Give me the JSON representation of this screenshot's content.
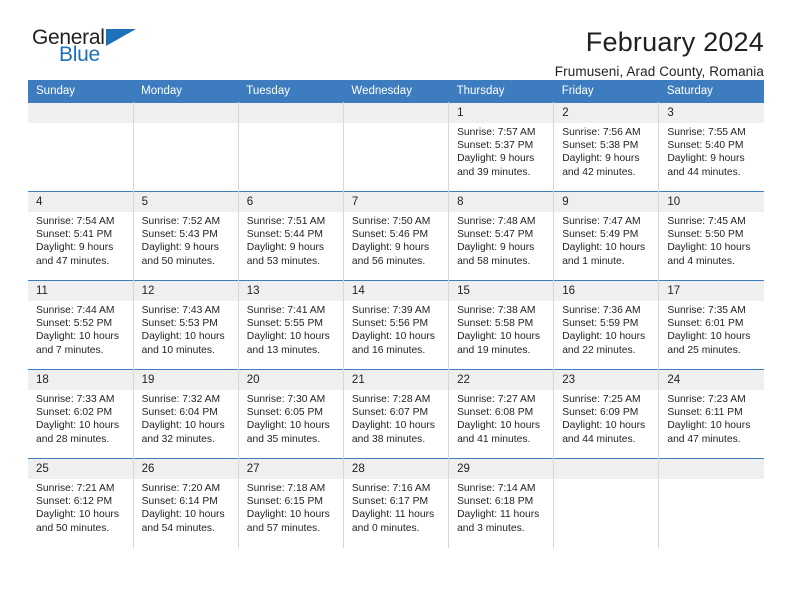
{
  "logo": {
    "text_top": "General",
    "text_bottom": "Blue",
    "triangle_color": "#1d71b8"
  },
  "header": {
    "month_title": "February 2024",
    "location": "Frumuseni, Arad County, Romania"
  },
  "colors": {
    "header_blue": "#3c7cbf",
    "daynum_band": "#efefef",
    "text": "#231f20"
  },
  "weekday_headers": [
    "Sunday",
    "Monday",
    "Tuesday",
    "Wednesday",
    "Thursday",
    "Friday",
    "Saturday"
  ],
  "weeks": [
    [
      {
        "day": "",
        "lines": ""
      },
      {
        "day": "",
        "lines": ""
      },
      {
        "day": "",
        "lines": ""
      },
      {
        "day": "",
        "lines": ""
      },
      {
        "day": "1",
        "lines": "Sunrise: 7:57 AM\nSunset: 5:37 PM\nDaylight: 9 hours\nand 39 minutes."
      },
      {
        "day": "2",
        "lines": "Sunrise: 7:56 AM\nSunset: 5:38 PM\nDaylight: 9 hours\nand 42 minutes."
      },
      {
        "day": "3",
        "lines": "Sunrise: 7:55 AM\nSunset: 5:40 PM\nDaylight: 9 hours\nand 44 minutes."
      }
    ],
    [
      {
        "day": "4",
        "lines": "Sunrise: 7:54 AM\nSunset: 5:41 PM\nDaylight: 9 hours\nand 47 minutes."
      },
      {
        "day": "5",
        "lines": "Sunrise: 7:52 AM\nSunset: 5:43 PM\nDaylight: 9 hours\nand 50 minutes."
      },
      {
        "day": "6",
        "lines": "Sunrise: 7:51 AM\nSunset: 5:44 PM\nDaylight: 9 hours\nand 53 minutes."
      },
      {
        "day": "7",
        "lines": "Sunrise: 7:50 AM\nSunset: 5:46 PM\nDaylight: 9 hours\nand 56 minutes."
      },
      {
        "day": "8",
        "lines": "Sunrise: 7:48 AM\nSunset: 5:47 PM\nDaylight: 9 hours\nand 58 minutes."
      },
      {
        "day": "9",
        "lines": "Sunrise: 7:47 AM\nSunset: 5:49 PM\nDaylight: 10 hours\nand 1 minute."
      },
      {
        "day": "10",
        "lines": "Sunrise: 7:45 AM\nSunset: 5:50 PM\nDaylight: 10 hours\nand 4 minutes."
      }
    ],
    [
      {
        "day": "11",
        "lines": "Sunrise: 7:44 AM\nSunset: 5:52 PM\nDaylight: 10 hours\nand 7 minutes."
      },
      {
        "day": "12",
        "lines": "Sunrise: 7:43 AM\nSunset: 5:53 PM\nDaylight: 10 hours\nand 10 minutes."
      },
      {
        "day": "13",
        "lines": "Sunrise: 7:41 AM\nSunset: 5:55 PM\nDaylight: 10 hours\nand 13 minutes."
      },
      {
        "day": "14",
        "lines": "Sunrise: 7:39 AM\nSunset: 5:56 PM\nDaylight: 10 hours\nand 16 minutes."
      },
      {
        "day": "15",
        "lines": "Sunrise: 7:38 AM\nSunset: 5:58 PM\nDaylight: 10 hours\nand 19 minutes."
      },
      {
        "day": "16",
        "lines": "Sunrise: 7:36 AM\nSunset: 5:59 PM\nDaylight: 10 hours\nand 22 minutes."
      },
      {
        "day": "17",
        "lines": "Sunrise: 7:35 AM\nSunset: 6:01 PM\nDaylight: 10 hours\nand 25 minutes."
      }
    ],
    [
      {
        "day": "18",
        "lines": "Sunrise: 7:33 AM\nSunset: 6:02 PM\nDaylight: 10 hours\nand 28 minutes."
      },
      {
        "day": "19",
        "lines": "Sunrise: 7:32 AM\nSunset: 6:04 PM\nDaylight: 10 hours\nand 32 minutes."
      },
      {
        "day": "20",
        "lines": "Sunrise: 7:30 AM\nSunset: 6:05 PM\nDaylight: 10 hours\nand 35 minutes."
      },
      {
        "day": "21",
        "lines": "Sunrise: 7:28 AM\nSunset: 6:07 PM\nDaylight: 10 hours\nand 38 minutes."
      },
      {
        "day": "22",
        "lines": "Sunrise: 7:27 AM\nSunset: 6:08 PM\nDaylight: 10 hours\nand 41 minutes."
      },
      {
        "day": "23",
        "lines": "Sunrise: 7:25 AM\nSunset: 6:09 PM\nDaylight: 10 hours\nand 44 minutes."
      },
      {
        "day": "24",
        "lines": "Sunrise: 7:23 AM\nSunset: 6:11 PM\nDaylight: 10 hours\nand 47 minutes."
      }
    ],
    [
      {
        "day": "25",
        "lines": "Sunrise: 7:21 AM\nSunset: 6:12 PM\nDaylight: 10 hours\nand 50 minutes."
      },
      {
        "day": "26",
        "lines": "Sunrise: 7:20 AM\nSunset: 6:14 PM\nDaylight: 10 hours\nand 54 minutes."
      },
      {
        "day": "27",
        "lines": "Sunrise: 7:18 AM\nSunset: 6:15 PM\nDaylight: 10 hours\nand 57 minutes."
      },
      {
        "day": "28",
        "lines": "Sunrise: 7:16 AM\nSunset: 6:17 PM\nDaylight: 11 hours\nand 0 minutes."
      },
      {
        "day": "29",
        "lines": "Sunrise: 7:14 AM\nSunset: 6:18 PM\nDaylight: 11 hours\nand 3 minutes."
      },
      {
        "day": "",
        "lines": ""
      },
      {
        "day": "",
        "lines": ""
      }
    ]
  ]
}
